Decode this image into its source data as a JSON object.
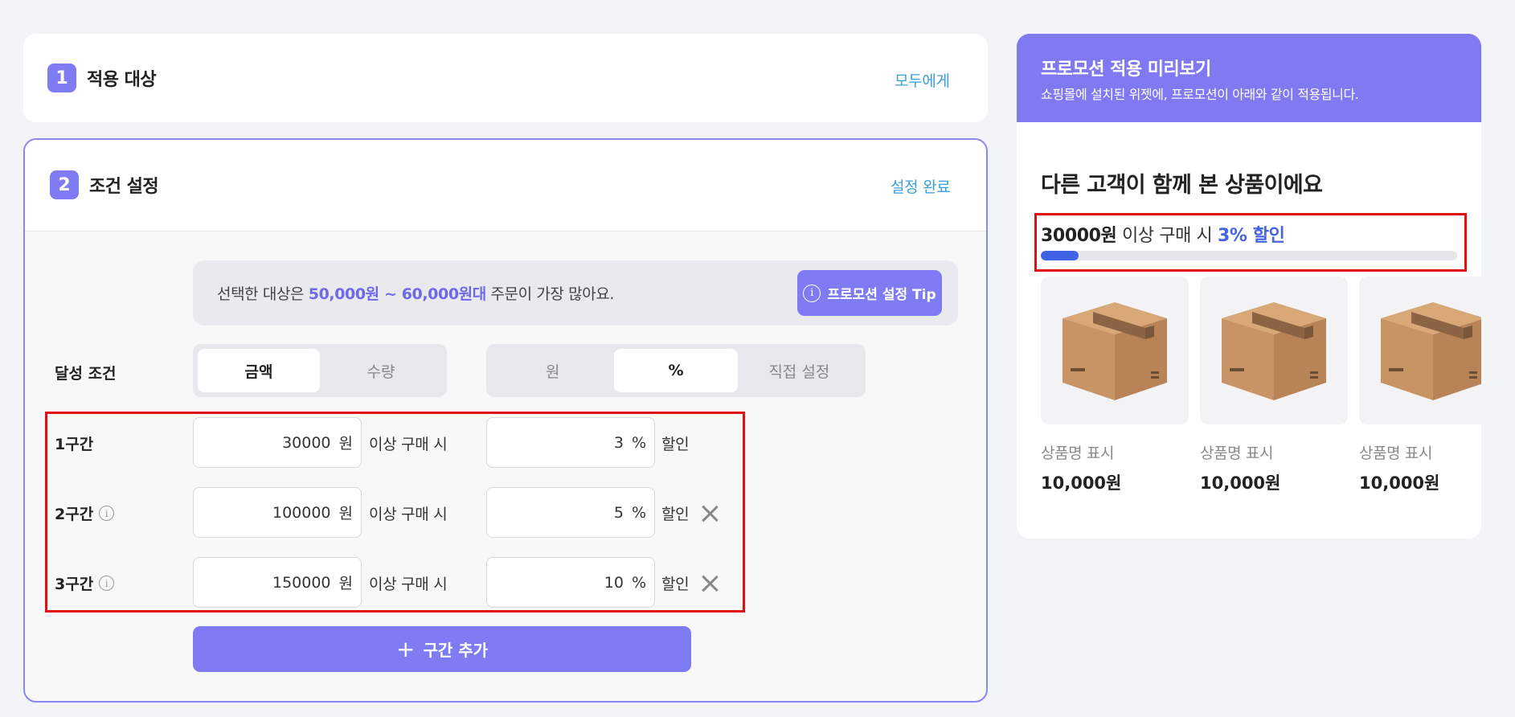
{
  "step1": {
    "number": "1",
    "title": "적용 대상",
    "action": "모두에게"
  },
  "step2": {
    "number": "2",
    "title": "조건 설정",
    "action": "설정 완료",
    "tip": {
      "prefix": "선택한 대상은 ",
      "highlight": "50,000원 ~ 60,000원대",
      "suffix": " 주문이 가장 많아요.",
      "button_label": "프로모션 설정 Tip"
    },
    "condition_label": "달성 조건",
    "condition_type": {
      "options": [
        "금액",
        "수량"
      ],
      "selected": "금액"
    },
    "discount_type": {
      "options": [
        "원",
        "%",
        "직접 설정"
      ],
      "selected": "%"
    },
    "tiers": [
      {
        "label": "1구간",
        "amount": "30000",
        "amount_unit": "원",
        "amount_suffix": "이상 구매 시",
        "discount": "3",
        "discount_unit": "%",
        "discount_suffix": "할인",
        "removable": false,
        "has_info": false
      },
      {
        "label": "2구간",
        "amount": "100000",
        "amount_unit": "원",
        "amount_suffix": "이상 구매 시",
        "discount": "5",
        "discount_unit": "%",
        "discount_suffix": "할인",
        "removable": true,
        "has_info": true
      },
      {
        "label": "3구간",
        "amount": "150000",
        "amount_unit": "원",
        "amount_suffix": "이상 구매 시",
        "discount": "10",
        "discount_unit": "%",
        "discount_suffix": "할인",
        "removable": true,
        "has_info": true
      }
    ],
    "add_tier_label": "구간 추가"
  },
  "preview": {
    "title": "프로모션 적용 미리보기",
    "subtitle": "쇼핑몰에 설치된 위젯에, 프로모션이 아래와 같이 적용됩니다.",
    "widget_title": "다른 고객이 함께 본 상품이에요",
    "promo": {
      "amount": "30000원",
      "middle": " 이상 구매 시 ",
      "discount": "3% 할인"
    },
    "progress_fraction": 0.09,
    "products": [
      {
        "name": "상품명 표시",
        "price": "10,000원"
      },
      {
        "name": "상품명 표시",
        "price": "10,000원"
      },
      {
        "name": "상품명 표시",
        "price": "10,000원"
      }
    ]
  },
  "colors": {
    "accent": "#7f7bf3",
    "preview_header": "#8079f2",
    "link": "#3aa0d8",
    "highlight_blue": "#4663e0",
    "annotation_red": "#e01010"
  }
}
